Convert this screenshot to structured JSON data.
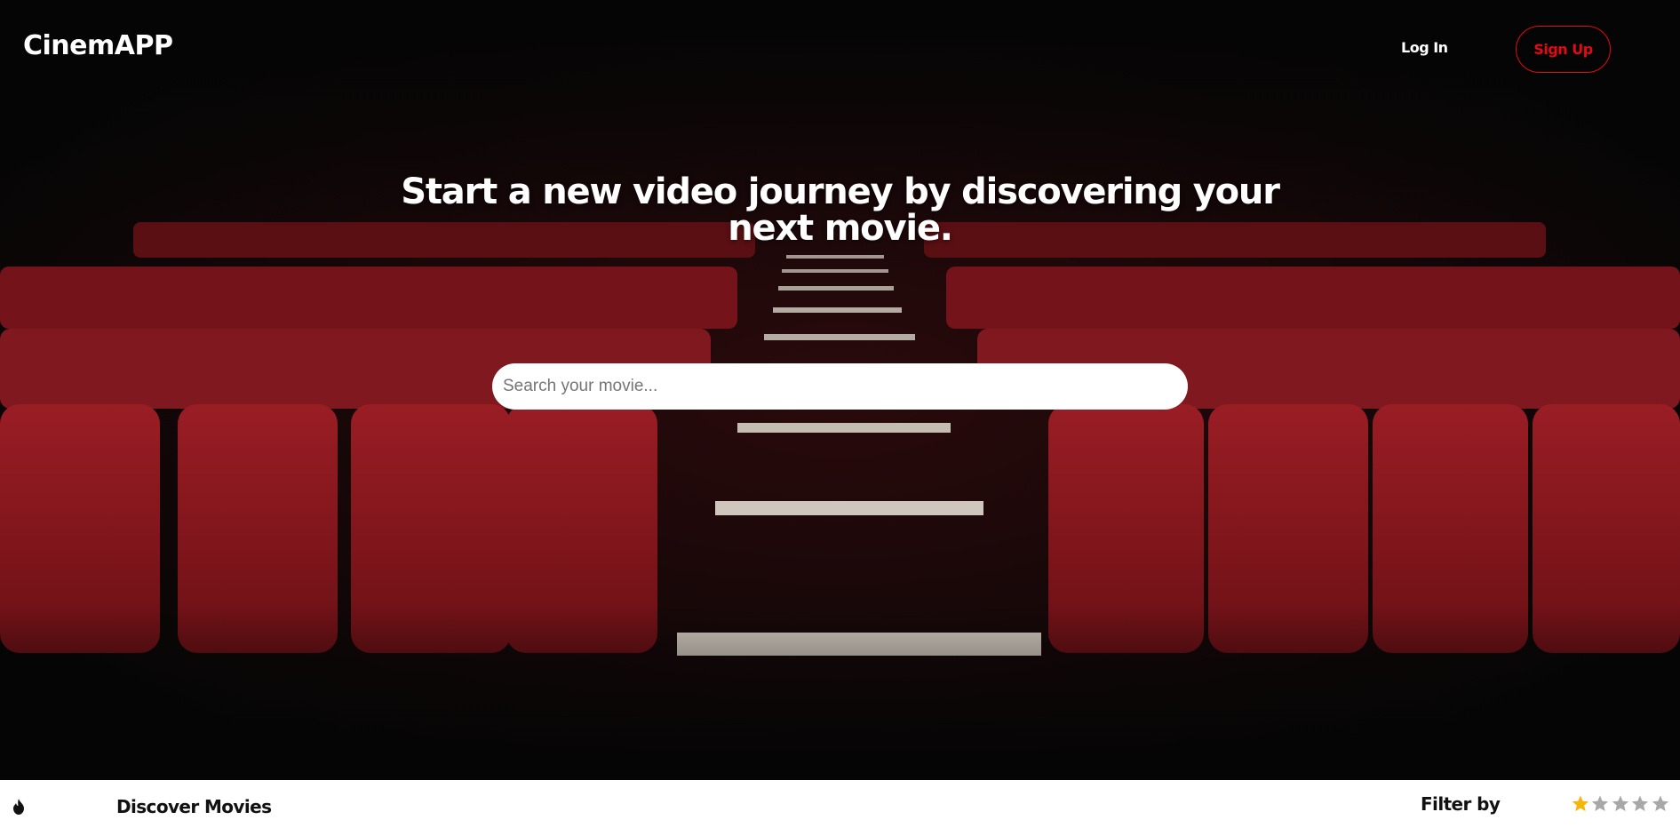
{
  "navbar": {
    "logo": "CinemAPP",
    "login_label": "Log In",
    "signup_label": "Sign Up"
  },
  "hero": {
    "headline": "Start a new video journey by discovering your next movie.",
    "search_placeholder": "Search your movie...",
    "search_value": ""
  },
  "bottom_bar": {
    "icon": "flame-icon",
    "discover_label": "Discover Movies",
    "filter_label": "Filter by",
    "rating_filter": {
      "selected": 1,
      "max": 5
    }
  },
  "colors": {
    "accent": "#e50914",
    "seat_red": "#8a1a20",
    "star_active": "#f5b50a",
    "star_inactive": "#a8a8a8",
    "hero_background": "#050505"
  }
}
